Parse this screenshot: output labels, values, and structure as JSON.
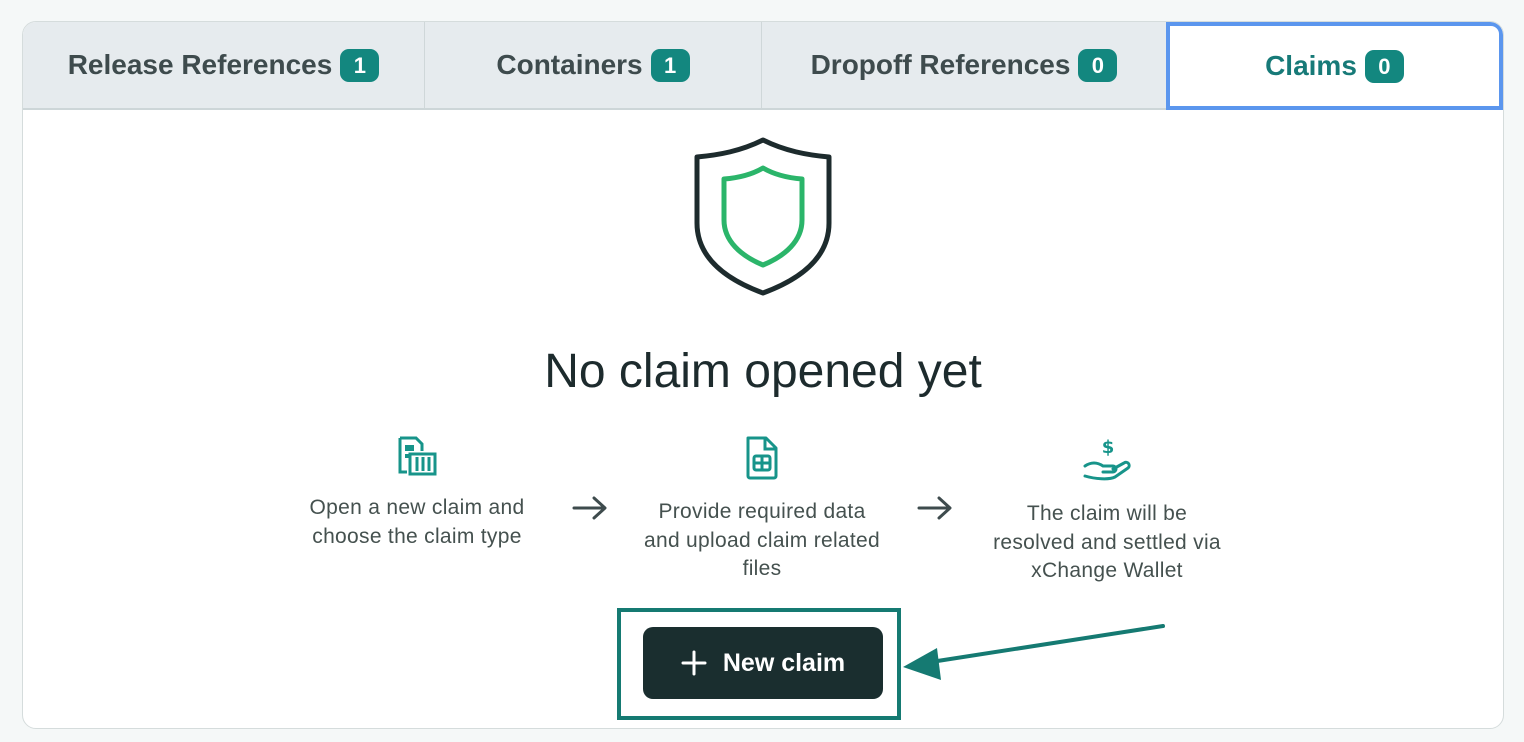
{
  "tabs": [
    {
      "label": "Release References",
      "count": "1"
    },
    {
      "label": "Containers",
      "count": "1"
    },
    {
      "label": "Dropoff References",
      "count": "0"
    },
    {
      "label": "Claims",
      "count": "0"
    }
  ],
  "active_tab": "Claims",
  "empty_state": {
    "icon": "shield-icon",
    "title": "No claim opened yet",
    "steps": [
      {
        "icon": "document-container-icon",
        "text": "Open a new claim and choose the claim type"
      },
      {
        "icon": "file-table-icon",
        "text": "Provide required data and upload claim related files"
      },
      {
        "icon": "hand-dollar-icon",
        "text": "The claim will be resolved and settled via xChange Wallet"
      }
    ]
  },
  "new_claim_button": {
    "label": "New claim",
    "icon": "plus-icon"
  },
  "colors": {
    "accent": "#13877f",
    "active_tab_border": "#5b96ee",
    "button_bg": "#1a2e2f",
    "shield_inner": "#2bb56a",
    "annotation": "#157a72"
  }
}
